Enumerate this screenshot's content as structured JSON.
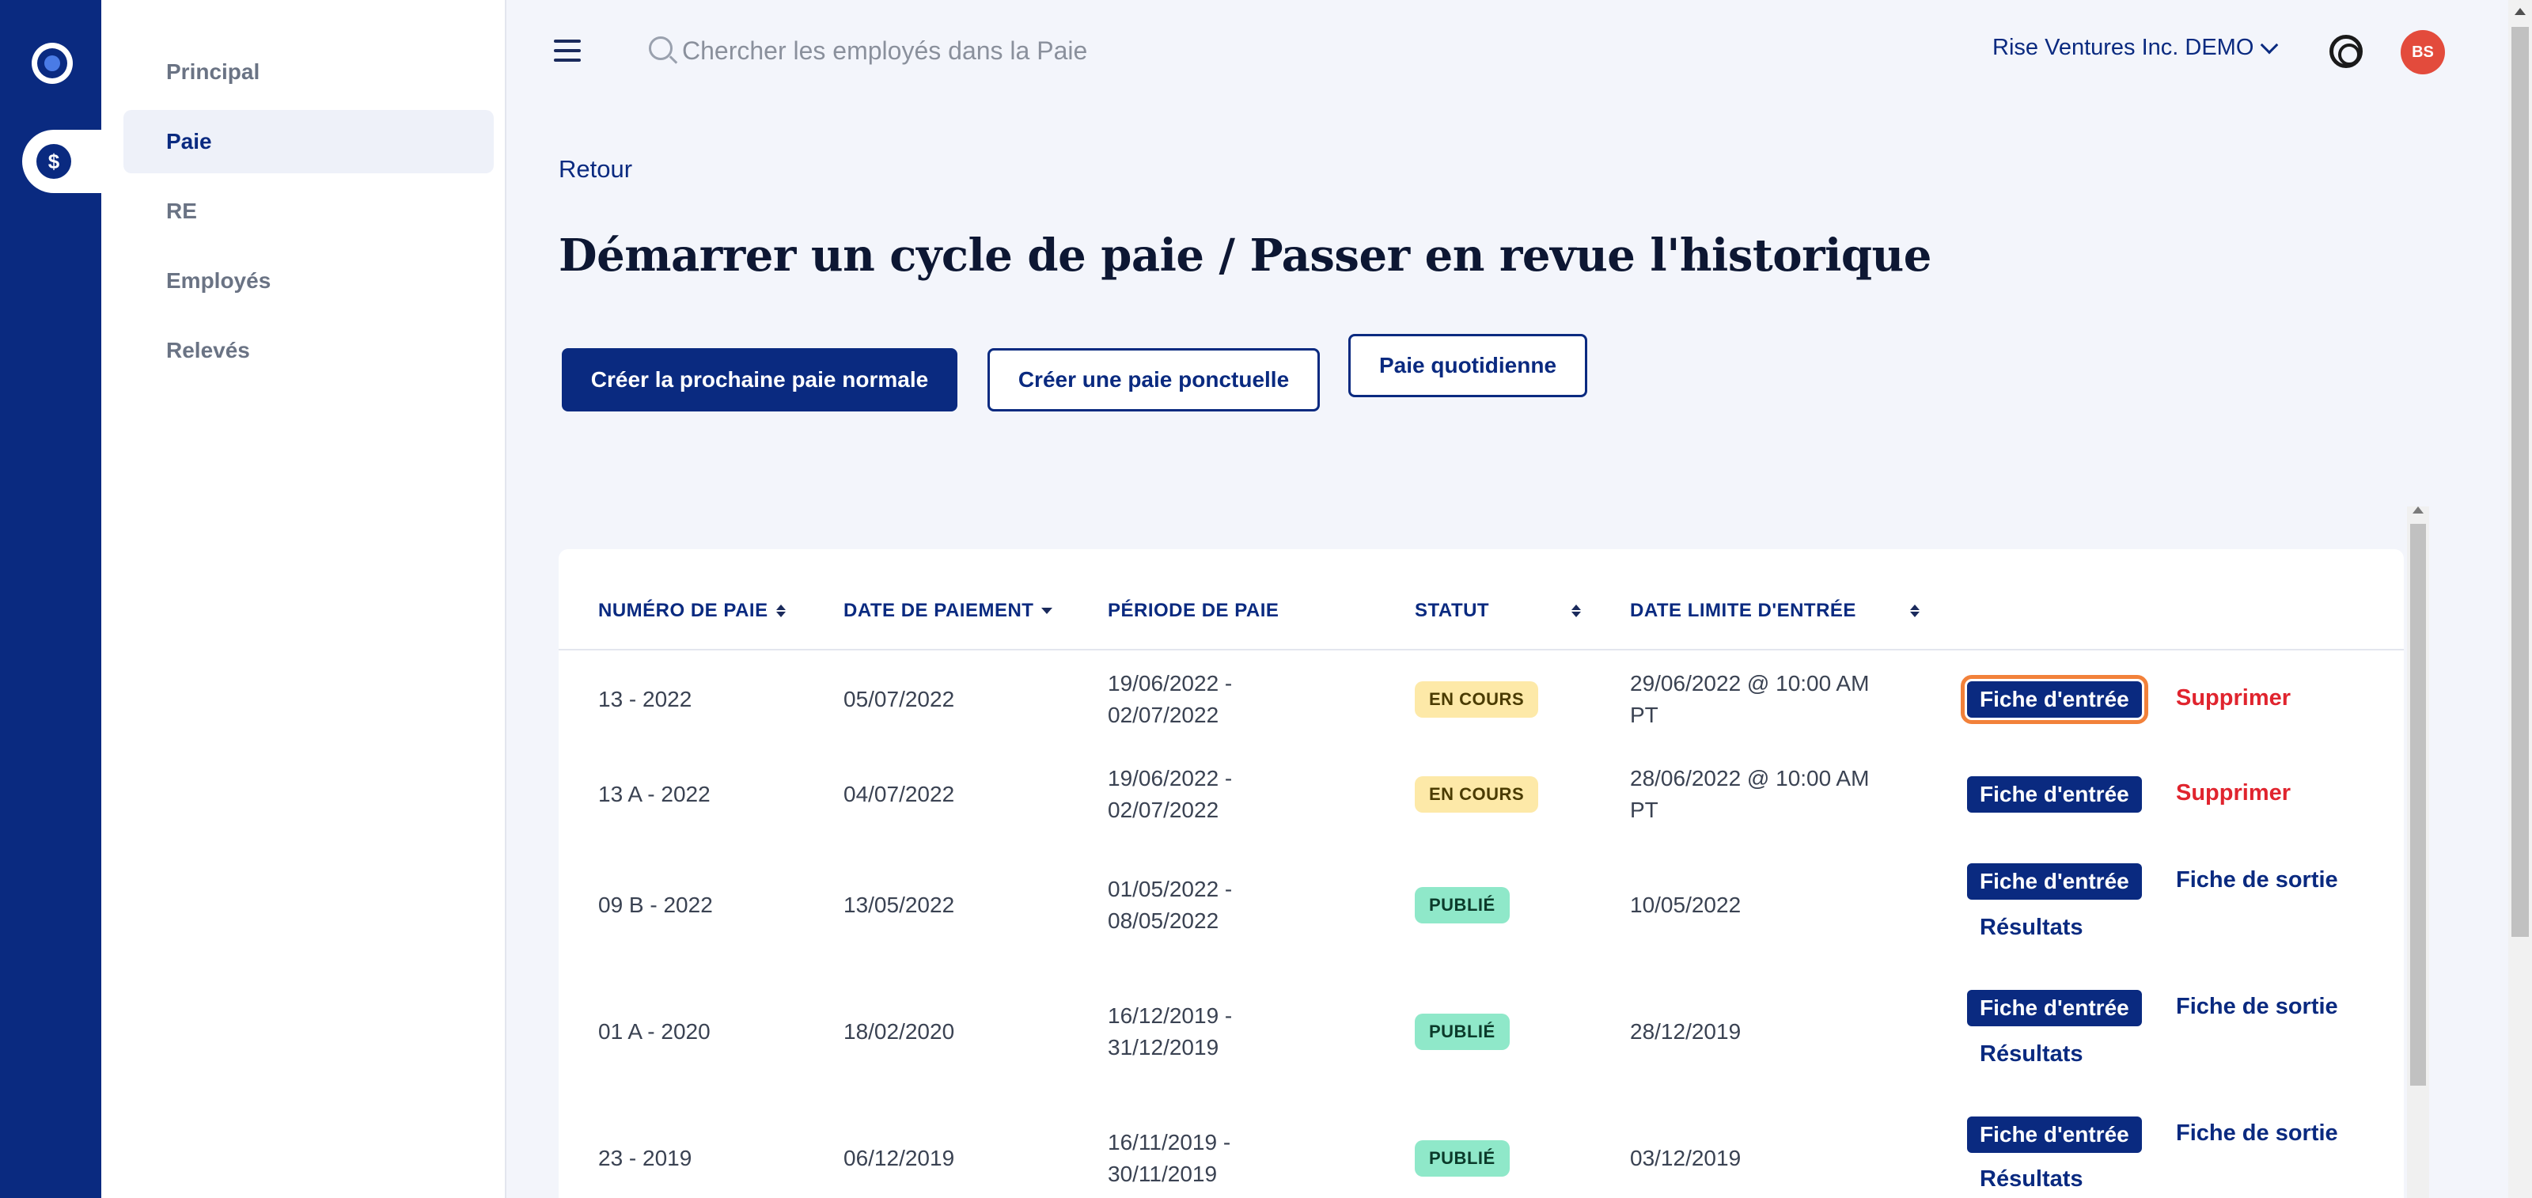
{
  "app": {
    "logo_icon": "app-logo-icon",
    "payroll_icon": "dollar-coin-icon"
  },
  "sidebar": {
    "items": [
      {
        "label": "Principal"
      },
      {
        "label": "Paie",
        "active": true
      },
      {
        "label": "RE"
      },
      {
        "label": "Employés"
      },
      {
        "label": "Relevés"
      }
    ]
  },
  "topbar": {
    "search_placeholder": "Chercher les employés dans la Paie",
    "company": "Rise Ventures Inc. DEMO",
    "avatar_initials": "BS"
  },
  "main": {
    "back": "Retour",
    "title": "Démarrer un cycle de paie / Passer en revue l'historique",
    "buttons": {
      "next_regular": "Créer la prochaine paie normale",
      "one_time": "Créer une paie ponctuelle",
      "daily": "Paie quotidienne"
    }
  },
  "table": {
    "headers": [
      "NUMÉRO DE PAIE",
      "DATE DE PAIEMENT",
      "PÉRIODE DE PAIE",
      "STATUT",
      "DATE LIMITE D'ENTRÉE"
    ],
    "action_labels": {
      "input": "Fiche d'entrée",
      "delete": "Supprimer",
      "output": "Fiche de sortie",
      "results": "Résultats"
    },
    "rows": [
      {
        "number": "13 - 2022",
        "pay_date": "05/07/2022",
        "period_start": "19/06/2022 -",
        "period_end": "02/07/2022",
        "status": "EN COURS",
        "deadline_1": "29/06/2022 @ 10:00 AM",
        "deadline_2": "PT"
      },
      {
        "number": "13 A - 2022",
        "pay_date": "04/07/2022",
        "period_start": "19/06/2022 -",
        "period_end": "02/07/2022",
        "status": "EN COURS",
        "deadline_1": "28/06/2022 @ 10:00 AM",
        "deadline_2": "PT"
      },
      {
        "number": "09 B - 2022",
        "pay_date": "13/05/2022",
        "period_start": "01/05/2022 -",
        "period_end": "08/05/2022",
        "status": "PUBLIÉ",
        "deadline_1": "10/05/2022",
        "deadline_2": ""
      },
      {
        "number": "01 A - 2020",
        "pay_date": "18/02/2020",
        "period_start": "16/12/2019 -",
        "period_end": "31/12/2019",
        "status": "PUBLIÉ",
        "deadline_1": "28/12/2019",
        "deadline_2": ""
      },
      {
        "number": "23 - 2019",
        "pay_date": "06/12/2019",
        "period_start": "16/11/2019 -",
        "period_end": "30/11/2019",
        "status": "PUBLIÉ",
        "deadline_1": "03/12/2019",
        "deadline_2": ""
      }
    ]
  },
  "colors": {
    "brand": "#0a2a80",
    "danger": "#e0242e",
    "running": "#fde9a8",
    "published": "#8fe8c9",
    "focus": "#f2813a"
  }
}
